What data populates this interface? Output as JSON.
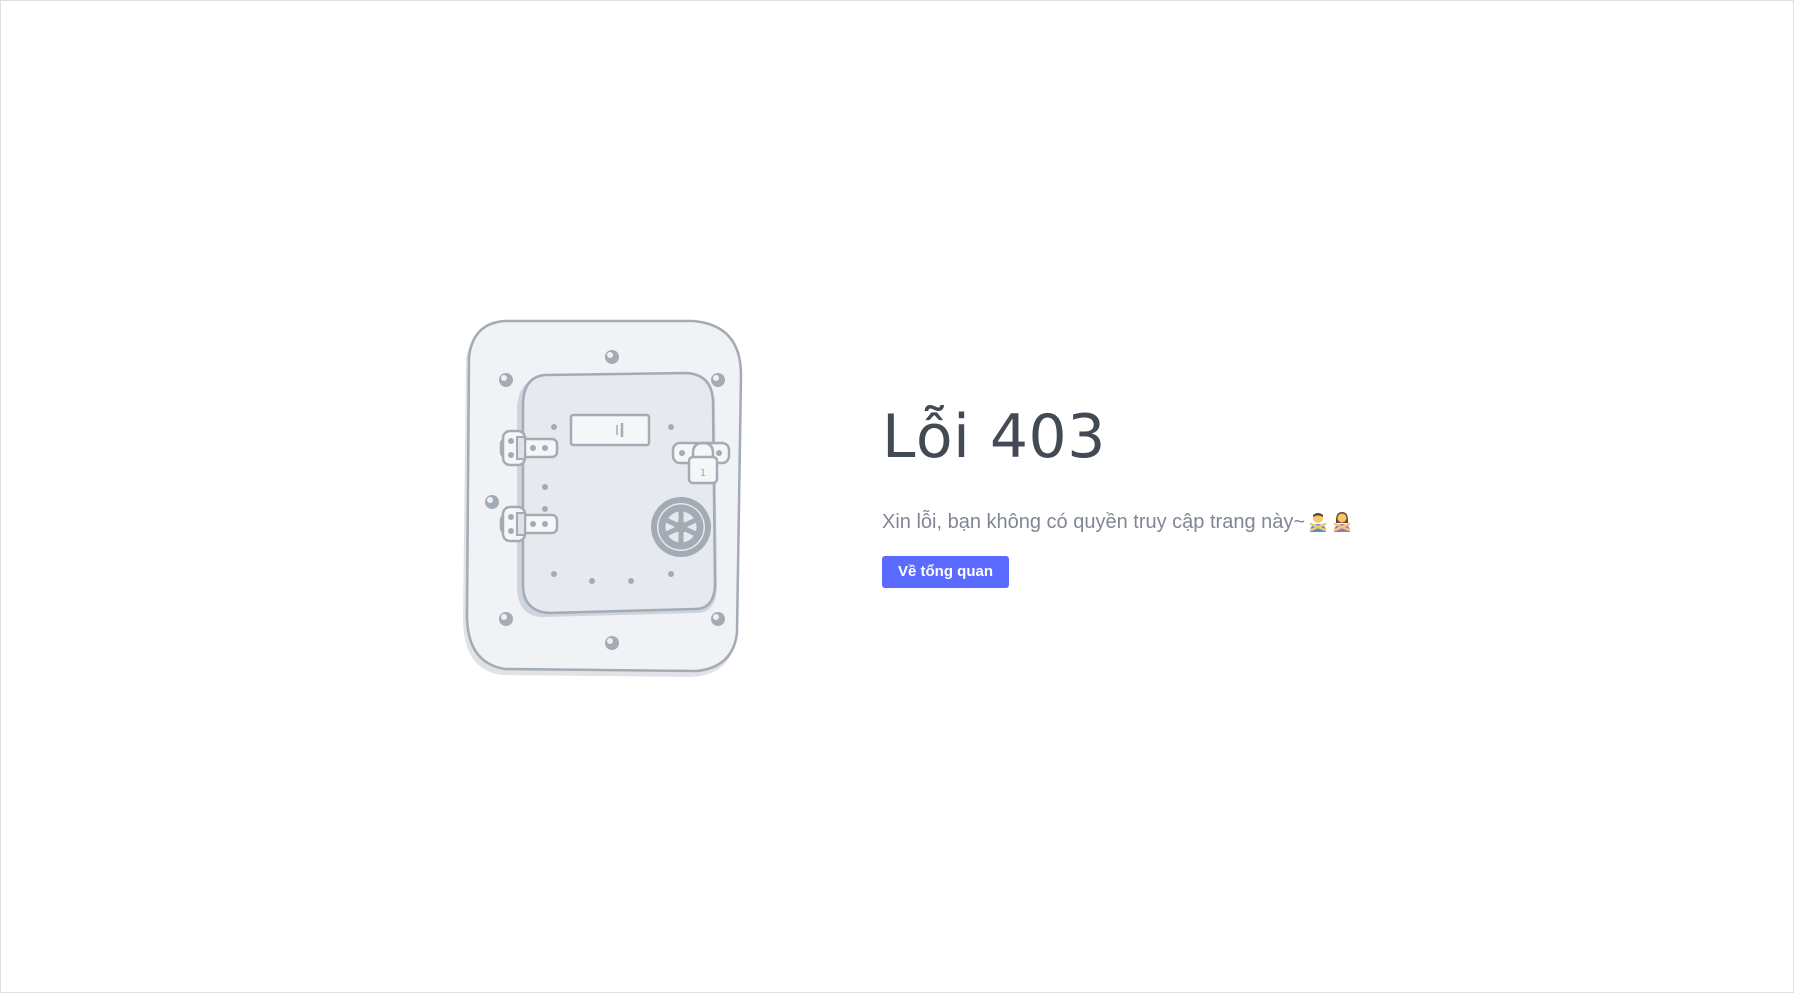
{
  "error": {
    "title": "Lỗi 403",
    "description": "Xin lỗi, bạn không có quyền truy cập trang này~",
    "back_button_label": "Về tổng quan",
    "illustration_icon": "vault-door-icon",
    "emoji_icons": [
      "person-gesturing-no-man-icon",
      "person-gesturing-no-woman-icon"
    ]
  },
  "colors": {
    "button_bg": "#5b6bff",
    "title": "#434a54",
    "description": "#808695"
  }
}
